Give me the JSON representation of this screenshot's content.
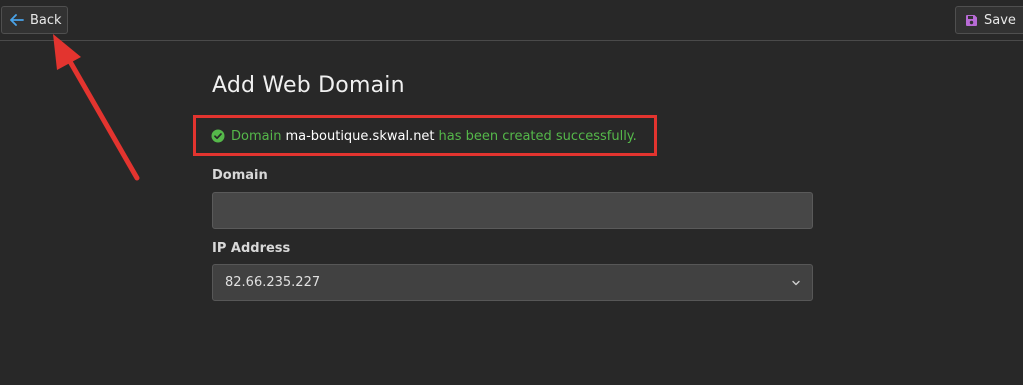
{
  "toolbar": {
    "back_label": "Back",
    "save_label": "Save"
  },
  "page": {
    "title": "Add Web Domain"
  },
  "alert": {
    "prefix": "Domain",
    "domain": "ma-boutique.skwal.net",
    "suffix": "has been created successfully.",
    "icon": "check-circle-icon"
  },
  "form": {
    "domain_label": "Domain",
    "domain_value": "",
    "ip_label": "IP Address",
    "ip_value": "82.66.235.227"
  },
  "colors": {
    "background": "#282828",
    "success": "#55b84a",
    "highlight": "#e3342f",
    "save_icon": "#b86bd6",
    "back_icon": "#4aa3e8"
  }
}
